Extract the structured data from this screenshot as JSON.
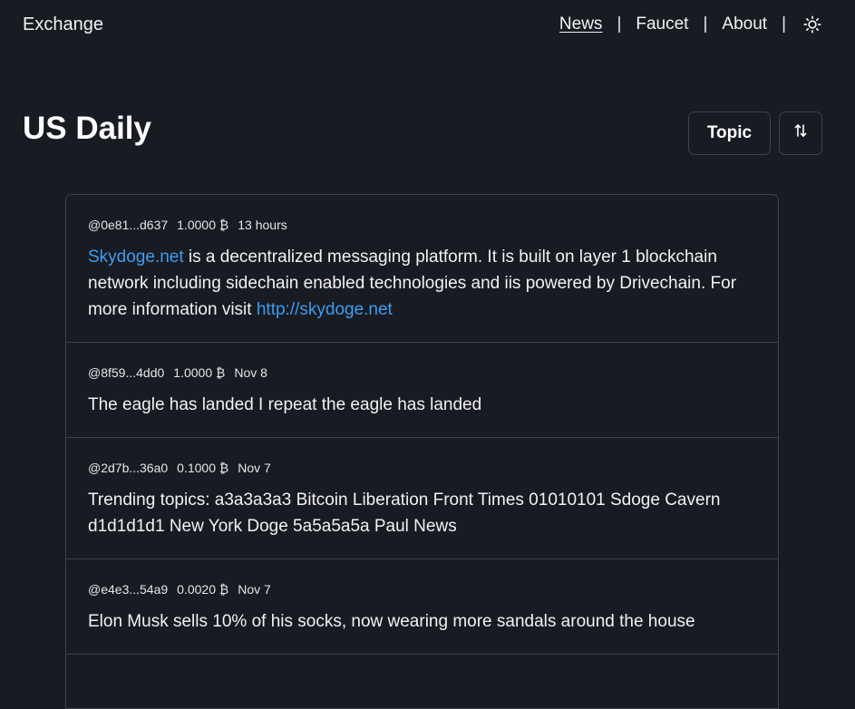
{
  "header": {
    "brand": "Exchange",
    "nav": [
      {
        "label": "News",
        "active": true
      },
      {
        "label": "Faucet",
        "active": false
      },
      {
        "label": "About",
        "active": false
      }
    ],
    "separator": "|",
    "theme_icon": "sun-icon"
  },
  "page": {
    "title": "US Daily",
    "topic_button": "Topic",
    "sort_icon": "sort-arrows-icon"
  },
  "posts": [
    {
      "author": "@0e81...d637",
      "amount": "1.0000 ₿",
      "time": "13 hours",
      "link1": "Skydoge.net",
      "text1": " is a decentralized messaging platform. It is built on layer 1 blockchain network including sidechain enabled technologies and iis powered by Drivechain. For more information visit ",
      "link2": "http://skydoge.net"
    },
    {
      "author": "@8f59...4dd0",
      "amount": "1.0000 ₿",
      "time": "Nov 8",
      "text": "The eagle has landed I repeat the eagle has landed"
    },
    {
      "author": "@2d7b...36a0",
      "amount": "0.1000 ₿",
      "time": "Nov 7",
      "text": "Trending topics: a3a3a3a3 Bitcoin Liberation Front Times 01010101 Sdoge Cavern d1d1d1d1 New York Doge 5a5a5a5a Paul News"
    },
    {
      "author": "@e4e3...54a9",
      "amount": "0.0020 ₿",
      "time": "Nov 7",
      "text": "Elon Musk sells 10% of his socks, now wearing more sandals around the house"
    },
    {
      "author": "",
      "amount": "",
      "time": "",
      "text": ""
    }
  ]
}
